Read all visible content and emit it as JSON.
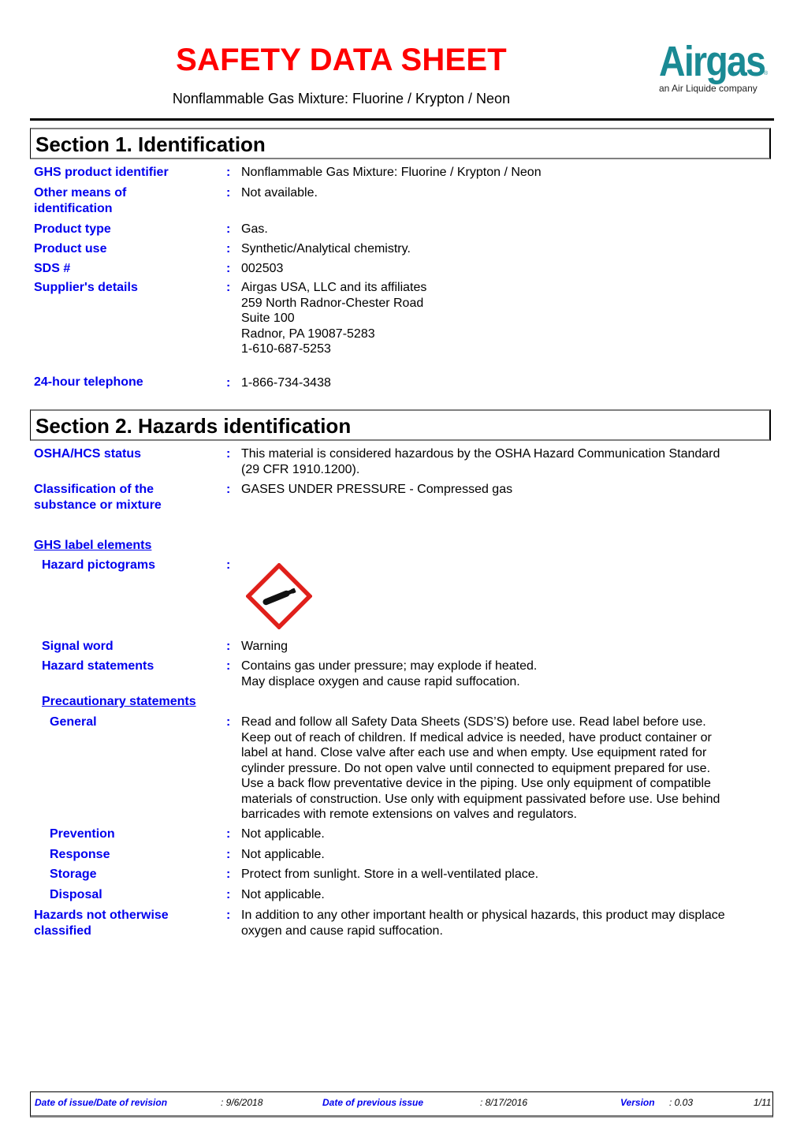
{
  "header": {
    "title": "SAFETY DATA SHEET",
    "subtitle": "Nonflammable Gas Mixture:  Fluorine / Krypton / Neon",
    "logo": {
      "wordmark": "Airgas",
      "registered": "®",
      "tagline": "an Air Liquide company",
      "brand_color": "#1a8a94"
    },
    "title_color": "#ff0000",
    "label_color": "#0000ee"
  },
  "section1": {
    "title": "Section 1. Identification",
    "rows": [
      {
        "label": "GHS product identifier",
        "value": [
          "Nonflammable Gas Mixture:  Fluorine / Krypton / Neon"
        ]
      },
      {
        "label": "Other means of identification",
        "value": [
          "Not available."
        ]
      },
      {
        "label": "Product type",
        "value": [
          "Gas."
        ]
      },
      {
        "label": "Product use",
        "value": [
          "Synthetic/Analytical chemistry."
        ]
      },
      {
        "label": "SDS #",
        "value": [
          "002503"
        ]
      },
      {
        "label": "Supplier's details",
        "value": [
          "Airgas USA, LLC and its affiliates",
          "259 North Radnor-Chester Road",
          "Suite 100",
          "Radnor, PA 19087-5283",
          "1-610-687-5253"
        ]
      },
      {
        "label": "24-hour telephone",
        "value": [
          "1-866-734-3438"
        ]
      }
    ]
  },
  "section2": {
    "title": "Section 2. Hazards identification",
    "osha_label": "OSHA/HCS status",
    "osha_value": [
      "This material is considered hazardous by the OSHA Hazard Communication Standard",
      "(29 CFR 1910.1200)."
    ],
    "classification_label_1": "Classification of the",
    "classification_label_2": "substance or mixture",
    "classification_value": "GASES UNDER PRESSURE - Compressed gas",
    "ghs_label_elements": "GHS label elements",
    "hazard_pictograms_label": "Hazard pictograms",
    "pictogram_icon": "gas-cylinder-icon",
    "pictogram_border_color": "#e0201b",
    "signal_word_label": "Signal word",
    "signal_word_value": "Warning",
    "hazard_statements_label": "Hazard statements",
    "hazard_statements_value": [
      "Contains gas under pressure; may explode if heated.",
      "May displace oxygen and cause rapid suffocation."
    ],
    "precautionary_statements": "Precautionary statements",
    "general_label": "General",
    "general_value": [
      "Read and follow all Safety Data Sheets (SDS’S) before use.  Read label before use.",
      "Keep out of reach of children.  If medical advice is needed, have product container or",
      "label at hand.  Close valve after each use and when empty.  Use equipment rated for",
      "cylinder pressure.  Do not open valve until connected to equipment prepared for use.",
      "Use a back flow preventative device in the piping.  Use only equipment of compatible",
      "materials of construction.  Use only with equipment passivated before use.  Use behind",
      "barricades with remote extensions on valves and regulators."
    ],
    "prevention_label": "Prevention",
    "prevention_value": "Not applicable.",
    "response_label": "Response",
    "response_value": "Not applicable.",
    "storage_label": "Storage",
    "storage_value": "Protect from sunlight.  Store in a well-ventilated place.",
    "disposal_label": "Disposal",
    "disposal_value": "Not applicable.",
    "hnoc_label_1": "Hazards not otherwise",
    "hnoc_label_2": "classified",
    "hnoc_value": [
      "In addition to any other important health or physical hazards, this product may displace",
      "oxygen and cause rapid suffocation."
    ]
  },
  "footer": {
    "issue_label": "Date of issue/Date of revision",
    "issue_value": ": 9/6/2018",
    "prev_label": "Date of previous issue",
    "prev_value": ": 8/17/2016",
    "version_label": "Version",
    "version_value": ": 0.03",
    "page": "1/11"
  }
}
